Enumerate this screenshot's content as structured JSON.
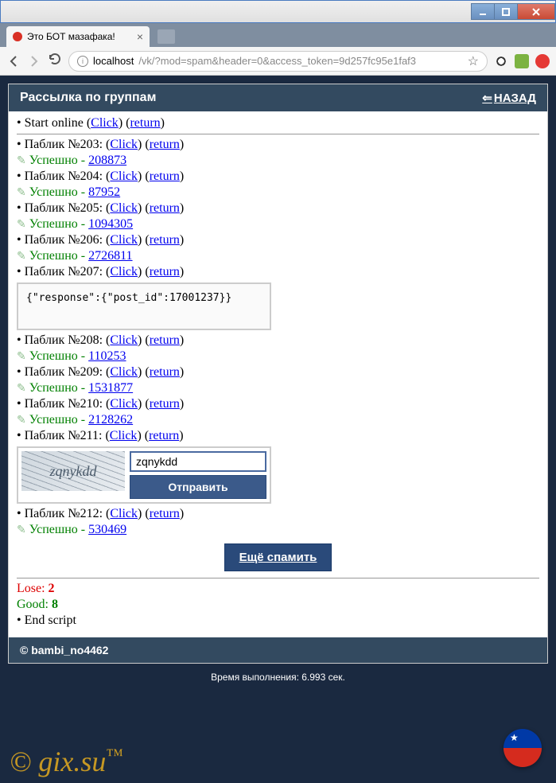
{
  "tab": {
    "title": "Это БОТ мазафака!"
  },
  "url": {
    "host": "localhost",
    "path": "/vk/?mod=spam&header=0&access_token=9d257fc95e1faf3"
  },
  "header": {
    "title": "Рассылка по группам",
    "back": "НАЗАД"
  },
  "start": {
    "label": "Start online",
    "click": "Click",
    "ret": "return"
  },
  "items": [
    {
      "n": "203",
      "click": "Click",
      "ret": "return",
      "ok": "Успешно",
      "id": "208873"
    },
    {
      "n": "204",
      "click": "Click",
      "ret": "return",
      "ok": "Успешно",
      "id": "87952"
    },
    {
      "n": "205",
      "click": "Click",
      "ret": "return",
      "ok": "Успешно",
      "id": "1094305"
    },
    {
      "n": "206",
      "click": "Click",
      "ret": "return",
      "ok": "Успешно",
      "id": "2726811"
    },
    {
      "n": "207",
      "click": "Click",
      "ret": "return",
      "resp": "{\"response\":{\"post_id\":17001237}}"
    },
    {
      "n": "208",
      "click": "Click",
      "ret": "return",
      "ok": "Успешно",
      "id": "110253"
    },
    {
      "n": "209",
      "click": "Click",
      "ret": "return",
      "ok": "Успешно",
      "id": "1531877"
    },
    {
      "n": "210",
      "click": "Click",
      "ret": "return",
      "ok": "Успешно",
      "id": "2128262"
    },
    {
      "n": "211",
      "click": "Click",
      "ret": "return",
      "captcha": {
        "text": "zqnykdd",
        "value": "zqnykdd",
        "submit": "Отправить"
      }
    },
    {
      "n": "212",
      "click": "Click",
      "ret": "return",
      "ok": "Успешно",
      "id": "530469"
    }
  ],
  "public_prefix": "Паблик №",
  "spam_more": "Ещё спамить",
  "lose": {
    "label": "Lose:",
    "val": "2"
  },
  "good": {
    "label": "Good:",
    "val": "8"
  },
  "end": "End script",
  "footer": "© bambi_no4462",
  "exec": "Время выполнения: 6.993 сек.",
  "watermark": "© gix.su",
  "watermark_tm": "™"
}
